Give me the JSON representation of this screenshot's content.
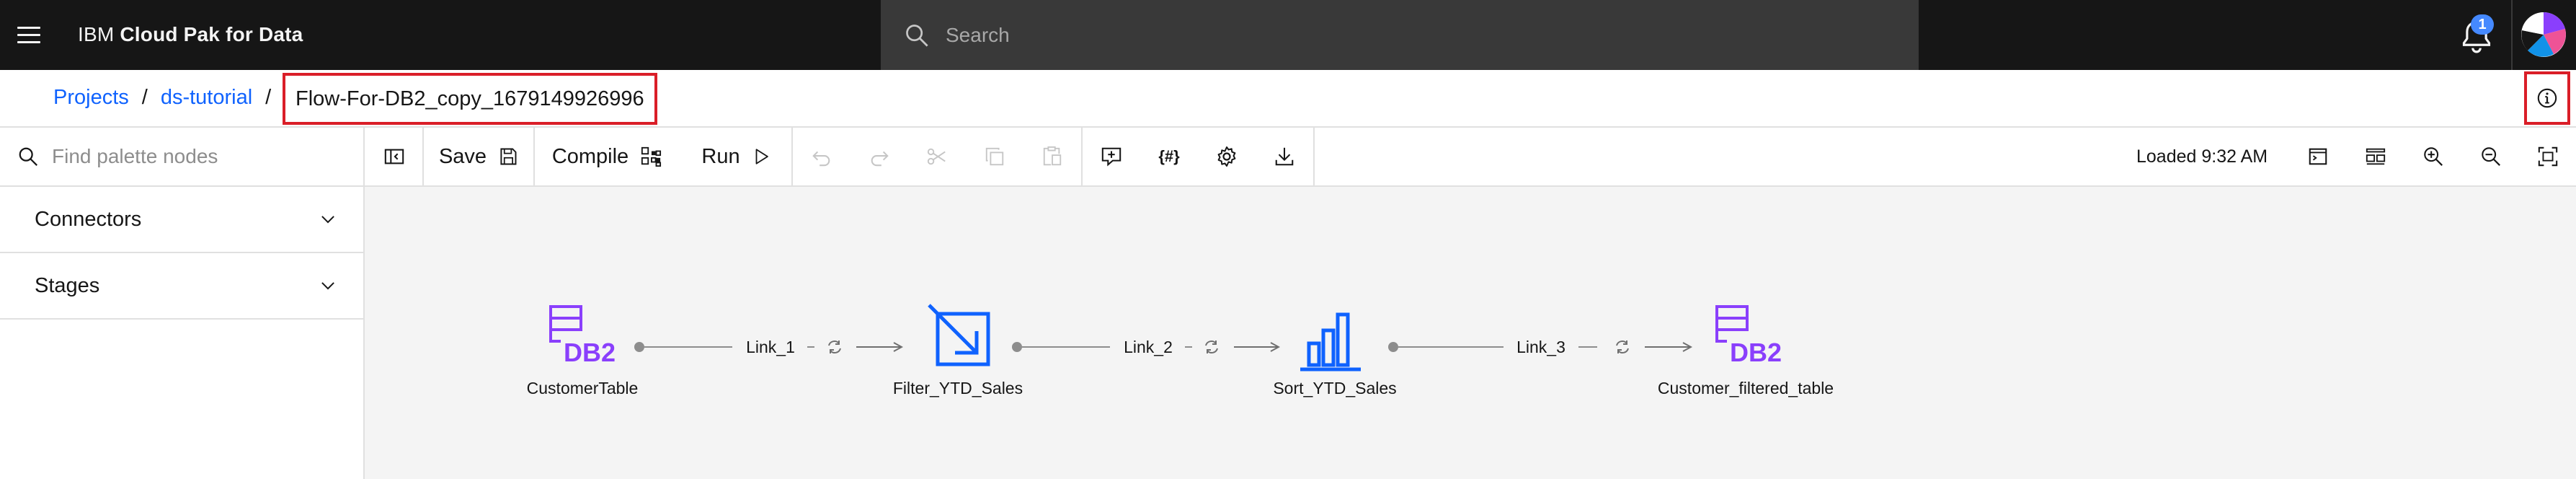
{
  "header": {
    "brand_prefix": "IBM ",
    "brand_bold": "Cloud Pak for Data",
    "search_placeholder": "Search",
    "notification_count": "1",
    "menu_icon": "hamburger-menu-icon",
    "notification_icon": "bell-icon"
  },
  "breadcrumb": {
    "items": [
      "Projects",
      "ds-tutorial"
    ],
    "separator": "/",
    "current": "Flow-For-DB2_copy_1679149926996",
    "info_icon": "information-icon"
  },
  "toolbar": {
    "palette_search_placeholder": "Find palette nodes",
    "save_label": "Save",
    "compile_label": "Compile",
    "run_label": "Run",
    "loaded_status": "Loaded 9:32 AM",
    "icons": [
      "sidebar-toggle-icon",
      "save-icon",
      "compile-icon",
      "run-play-icon",
      "undo-icon",
      "redo-icon",
      "cut-icon",
      "copy-icon",
      "paste-icon",
      "add-comment-icon",
      "parameters-icon",
      "settings-gear-icon",
      "download-icon",
      "terminal-icon",
      "arrange-layout-icon",
      "zoom-in-icon",
      "zoom-out-icon",
      "fit-to-screen-icon"
    ]
  },
  "sidebar": {
    "sections": [
      {
        "label": "Connectors"
      },
      {
        "label": "Stages"
      }
    ]
  },
  "flow": {
    "nodes": [
      {
        "label": "CustomerTable",
        "icon": "db2-connector-icon"
      },
      {
        "label": "Filter_YTD_Sales",
        "icon": "filter-stage-icon"
      },
      {
        "label": "Sort_YTD_Sales",
        "icon": "sort-stage-icon"
      },
      {
        "label": "Customer_filtered_table",
        "icon": "db2-connector-icon"
      }
    ],
    "links": [
      {
        "label": "Link_1"
      },
      {
        "label": "Link_2"
      },
      {
        "label": "Link_3"
      }
    ]
  },
  "colors": {
    "header_bg": "#161616",
    "search_bg": "#393939",
    "link_blue": "#0f62fe",
    "highlight_red": "#da1e28",
    "db2_purple": "#8a3ffc",
    "stage_blue": "#0f62fe",
    "canvas_bg": "#f4f4f4"
  }
}
